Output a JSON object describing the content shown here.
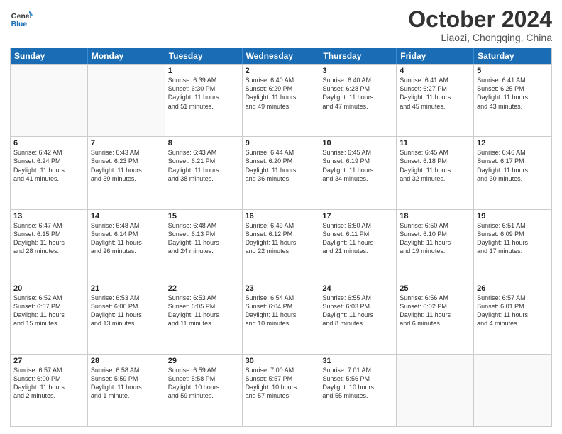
{
  "header": {
    "logo_text_general": "General",
    "logo_text_blue": "Blue",
    "month_title": "October 2024",
    "location": "Liaozi, Chongqing, China"
  },
  "days_of_week": [
    "Sunday",
    "Monday",
    "Tuesday",
    "Wednesday",
    "Thursday",
    "Friday",
    "Saturday"
  ],
  "weeks": [
    [
      {
        "day": "",
        "empty": true
      },
      {
        "day": "",
        "empty": true
      },
      {
        "day": "1",
        "sunrise": "Sunrise: 6:39 AM",
        "sunset": "Sunset: 6:30 PM",
        "daylight": "Daylight: 11 hours and 51 minutes."
      },
      {
        "day": "2",
        "sunrise": "Sunrise: 6:40 AM",
        "sunset": "Sunset: 6:29 PM",
        "daylight": "Daylight: 11 hours and 49 minutes."
      },
      {
        "day": "3",
        "sunrise": "Sunrise: 6:40 AM",
        "sunset": "Sunset: 6:28 PM",
        "daylight": "Daylight: 11 hours and 47 minutes."
      },
      {
        "day": "4",
        "sunrise": "Sunrise: 6:41 AM",
        "sunset": "Sunset: 6:27 PM",
        "daylight": "Daylight: 11 hours and 45 minutes."
      },
      {
        "day": "5",
        "sunrise": "Sunrise: 6:41 AM",
        "sunset": "Sunset: 6:25 PM",
        "daylight": "Daylight: 11 hours and 43 minutes."
      }
    ],
    [
      {
        "day": "6",
        "sunrise": "Sunrise: 6:42 AM",
        "sunset": "Sunset: 6:24 PM",
        "daylight": "Daylight: 11 hours and 41 minutes."
      },
      {
        "day": "7",
        "sunrise": "Sunrise: 6:43 AM",
        "sunset": "Sunset: 6:23 PM",
        "daylight": "Daylight: 11 hours and 39 minutes."
      },
      {
        "day": "8",
        "sunrise": "Sunrise: 6:43 AM",
        "sunset": "Sunset: 6:21 PM",
        "daylight": "Daylight: 11 hours and 38 minutes."
      },
      {
        "day": "9",
        "sunrise": "Sunrise: 6:44 AM",
        "sunset": "Sunset: 6:20 PM",
        "daylight": "Daylight: 11 hours and 36 minutes."
      },
      {
        "day": "10",
        "sunrise": "Sunrise: 6:45 AM",
        "sunset": "Sunset: 6:19 PM",
        "daylight": "Daylight: 11 hours and 34 minutes."
      },
      {
        "day": "11",
        "sunrise": "Sunrise: 6:45 AM",
        "sunset": "Sunset: 6:18 PM",
        "daylight": "Daylight: 11 hours and 32 minutes."
      },
      {
        "day": "12",
        "sunrise": "Sunrise: 6:46 AM",
        "sunset": "Sunset: 6:17 PM",
        "daylight": "Daylight: 11 hours and 30 minutes."
      }
    ],
    [
      {
        "day": "13",
        "sunrise": "Sunrise: 6:47 AM",
        "sunset": "Sunset: 6:15 PM",
        "daylight": "Daylight: 11 hours and 28 minutes."
      },
      {
        "day": "14",
        "sunrise": "Sunrise: 6:48 AM",
        "sunset": "Sunset: 6:14 PM",
        "daylight": "Daylight: 11 hours and 26 minutes."
      },
      {
        "day": "15",
        "sunrise": "Sunrise: 6:48 AM",
        "sunset": "Sunset: 6:13 PM",
        "daylight": "Daylight: 11 hours and 24 minutes."
      },
      {
        "day": "16",
        "sunrise": "Sunrise: 6:49 AM",
        "sunset": "Sunset: 6:12 PM",
        "daylight": "Daylight: 11 hours and 22 minutes."
      },
      {
        "day": "17",
        "sunrise": "Sunrise: 6:50 AM",
        "sunset": "Sunset: 6:11 PM",
        "daylight": "Daylight: 11 hours and 21 minutes."
      },
      {
        "day": "18",
        "sunrise": "Sunrise: 6:50 AM",
        "sunset": "Sunset: 6:10 PM",
        "daylight": "Daylight: 11 hours and 19 minutes."
      },
      {
        "day": "19",
        "sunrise": "Sunrise: 6:51 AM",
        "sunset": "Sunset: 6:09 PM",
        "daylight": "Daylight: 11 hours and 17 minutes."
      }
    ],
    [
      {
        "day": "20",
        "sunrise": "Sunrise: 6:52 AM",
        "sunset": "Sunset: 6:07 PM",
        "daylight": "Daylight: 11 hours and 15 minutes."
      },
      {
        "day": "21",
        "sunrise": "Sunrise: 6:53 AM",
        "sunset": "Sunset: 6:06 PM",
        "daylight": "Daylight: 11 hours and 13 minutes."
      },
      {
        "day": "22",
        "sunrise": "Sunrise: 6:53 AM",
        "sunset": "Sunset: 6:05 PM",
        "daylight": "Daylight: 11 hours and 11 minutes."
      },
      {
        "day": "23",
        "sunrise": "Sunrise: 6:54 AM",
        "sunset": "Sunset: 6:04 PM",
        "daylight": "Daylight: 11 hours and 10 minutes."
      },
      {
        "day": "24",
        "sunrise": "Sunrise: 6:55 AM",
        "sunset": "Sunset: 6:03 PM",
        "daylight": "Daylight: 11 hours and 8 minutes."
      },
      {
        "day": "25",
        "sunrise": "Sunrise: 6:56 AM",
        "sunset": "Sunset: 6:02 PM",
        "daylight": "Daylight: 11 hours and 6 minutes."
      },
      {
        "day": "26",
        "sunrise": "Sunrise: 6:57 AM",
        "sunset": "Sunset: 6:01 PM",
        "daylight": "Daylight: 11 hours and 4 minutes."
      }
    ],
    [
      {
        "day": "27",
        "sunrise": "Sunrise: 6:57 AM",
        "sunset": "Sunset: 6:00 PM",
        "daylight": "Daylight: 11 hours and 2 minutes."
      },
      {
        "day": "28",
        "sunrise": "Sunrise: 6:58 AM",
        "sunset": "Sunset: 5:59 PM",
        "daylight": "Daylight: 11 hours and 1 minute."
      },
      {
        "day": "29",
        "sunrise": "Sunrise: 6:59 AM",
        "sunset": "Sunset: 5:58 PM",
        "daylight": "Daylight: 10 hours and 59 minutes."
      },
      {
        "day": "30",
        "sunrise": "Sunrise: 7:00 AM",
        "sunset": "Sunset: 5:57 PM",
        "daylight": "Daylight: 10 hours and 57 minutes."
      },
      {
        "day": "31",
        "sunrise": "Sunrise: 7:01 AM",
        "sunset": "Sunset: 5:56 PM",
        "daylight": "Daylight: 10 hours and 55 minutes."
      },
      {
        "day": "",
        "empty": true
      },
      {
        "day": "",
        "empty": true
      }
    ]
  ]
}
